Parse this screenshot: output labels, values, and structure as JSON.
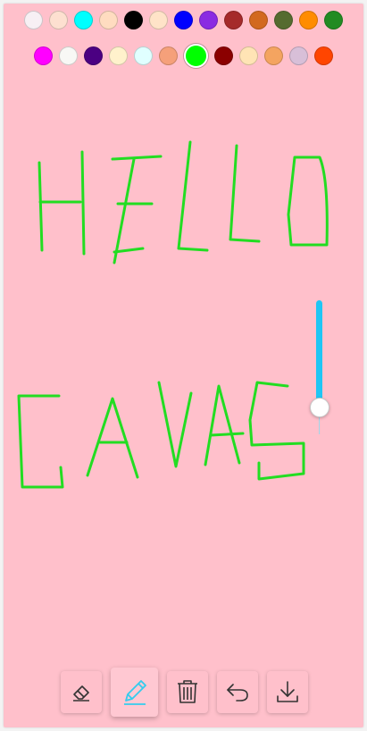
{
  "palette": {
    "row1": [
      "#f7f0f4",
      "#fde0d0",
      "#00ffff",
      "#ffdcc0",
      "#000000",
      "#ffe3c8",
      "#0000ff",
      "#8a2be2",
      "#a52a2a",
      "#d2691e",
      "#556b2f",
      "#ff8c00",
      "#228b22"
    ],
    "row2": [
      "#ff00ff",
      "#f8f8f5",
      "#4b0082",
      "#fff2cc",
      "#e0ffff",
      "#f5a07a",
      "#00ff00",
      "#8b0000",
      "#ffe4b5",
      "#f4a460",
      "#d8bfd8",
      "#ff4500"
    ],
    "selected": "#00ff00"
  },
  "drawing": {
    "stroke_color": "#22dd22",
    "words": [
      "HELLO",
      "CAVAS"
    ]
  },
  "brush_size": {
    "level": 0.8,
    "fill_color": "#1ec6f4"
  },
  "toolbar": {
    "tools": [
      "eraser-icon",
      "pencil-icon",
      "trash-icon",
      "undo-icon",
      "download-icon"
    ],
    "active_tool": "pencil-icon",
    "icon_color": "#333333",
    "active_icon_color": "#33ccee"
  }
}
